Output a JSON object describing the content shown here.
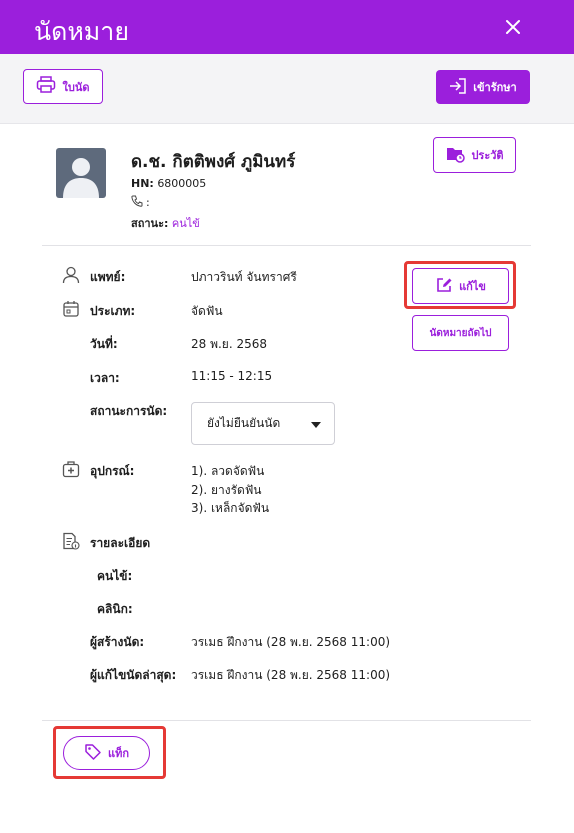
{
  "header": {
    "title": "นัดหมาย"
  },
  "toolbar": {
    "print_label": "ใบนัด",
    "treat_label": "เข้ารักษา"
  },
  "patient": {
    "name": "ด.ช. กิตติพงศ์ ภูมินทร์",
    "hn_label": "HN:",
    "hn": "6800005",
    "phone_label": ":",
    "status_label": "สถานะ:",
    "status": "คนไข้",
    "history_label": "ประวัติ"
  },
  "appointment": {
    "doctor_label": "แพทย์:",
    "doctor": "ปภาวรินท์ จันทราศรี",
    "type_label": "ประเภท:",
    "type": "จัดฟัน",
    "date_label": "วันที่:",
    "date": "28 พ.ย. 2568",
    "time_label": "เวลา:",
    "time": "11:15 - 12:15",
    "status_label": "สถานะการนัด:",
    "status_value": "ยังไม่ยืนยันนัด",
    "equipment_label": "อุปกรณ์:",
    "equipment": [
      "1). ลวดจัดฟัน",
      "2). ยางรัดฟัน",
      "3). เหล็กจัดฟัน"
    ],
    "edit_label": "แก้ไข",
    "next_label": "นัดหมายถัดไป"
  },
  "details": {
    "title": "รายละเอียด",
    "patient_label": "คนไข้:",
    "clinic_label": "คลินิก:",
    "creator_label": "ผู้สร้างนัด:",
    "creator": "วรเมธ ฝึกงาน (28 พ.ย. 2568 11:00)",
    "editor_label": "ผู้แก้ไขนัดล่าสุด:",
    "editor": "วรเมธ ฝึกงาน (28 พ.ย. 2568 11:00)"
  },
  "tag": {
    "label": "แท็ก"
  },
  "colors": {
    "accent": "#9b1fdc",
    "highlight": "#e53935"
  }
}
